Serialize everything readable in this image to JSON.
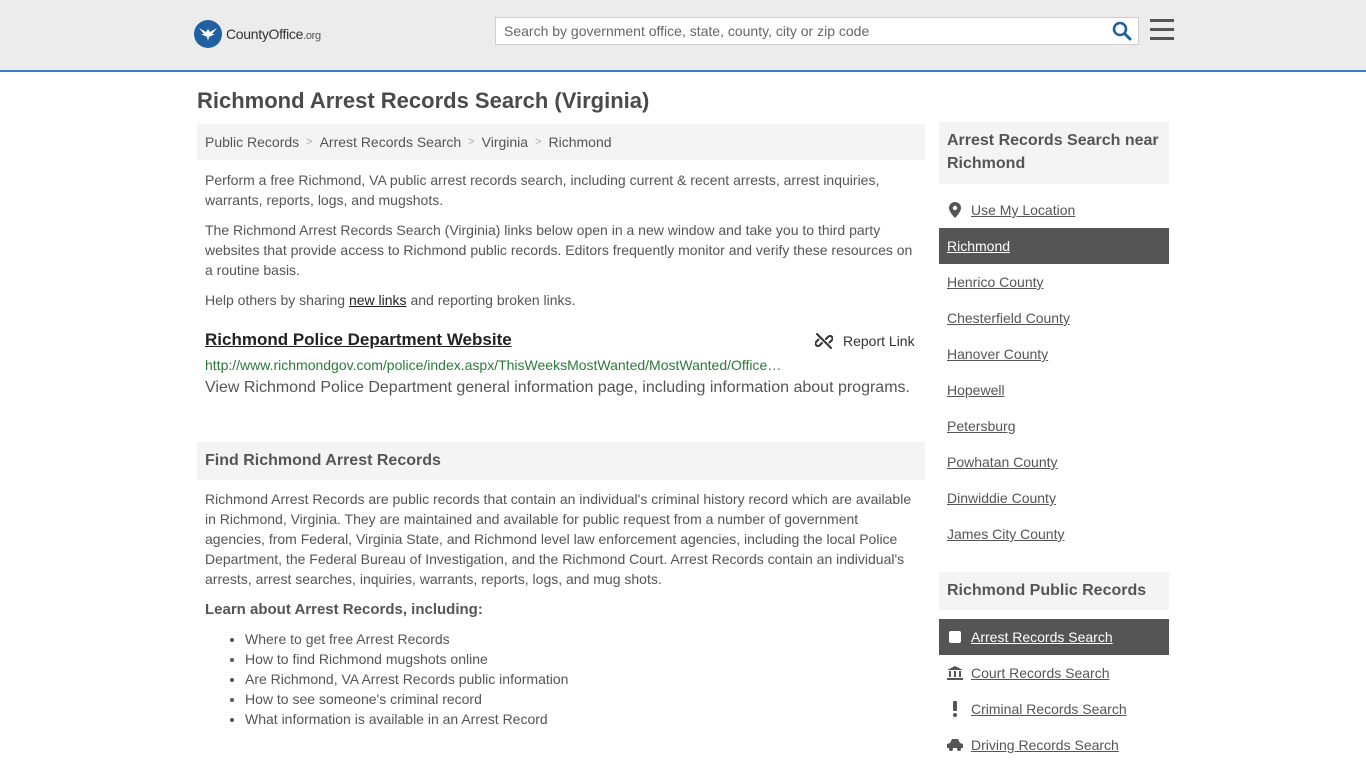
{
  "header": {
    "logo_text": "CountyOffice",
    "logo_suffix": ".org",
    "search_placeholder": "Search by government office, state, county, city or zip code"
  },
  "page_title": "Richmond Arrest Records Search (Virginia)",
  "breadcrumb": [
    "Public Records",
    "Arrest Records Search",
    "Virginia",
    "Richmond"
  ],
  "intro": {
    "p1": "Perform a free Richmond, VA public arrest records search, including current & recent arrests, arrest inquiries, warrants, reports, logs, and mugshots.",
    "p2": "The Richmond Arrest Records Search (Virginia) links below open in a new window and take you to third party websites that provide access to Richmond public records. Editors frequently monitor and verify these resources on a routine basis.",
    "p3_before": "Help others by sharing ",
    "p3_link": "new links",
    "p3_after": " and reporting broken links."
  },
  "listing": {
    "title": "Richmond Police Department Website",
    "report_label": "Report Link",
    "url": "http://www.richmondgov.com/police/index.aspx/ThisWeeksMostWanted/MostWanted/OfficeOfTheChief/index.aspx",
    "description": "View Richmond Police Department general information page, including information about programs."
  },
  "find_section": {
    "heading": "Find Richmond Arrest Records",
    "body": "Richmond Arrest Records are public records that contain an individual's criminal history record which are available in Richmond, Virginia. They are maintained and available for public request from a number of government agencies, from Federal, Virginia State, and Richmond level law enforcement agencies, including the local Police Department, the Federal Bureau of Investigation, and the Richmond Court. Arrest Records contain an individual's arrests, arrest searches, inquiries, warrants, reports, logs, and mug shots.",
    "learn_heading": "Learn about Arrest Records, including:",
    "learn_items": [
      "Where to get free Arrest Records",
      "How to find Richmond mugshots online",
      "Are Richmond, VA Arrest Records public information",
      "How to see someone's criminal record",
      "What information is available in an Arrest Record"
    ]
  },
  "sidebar": {
    "nearby_heading": "Arrest Records Search near Richmond",
    "use_location": "Use My Location",
    "nearby": [
      "Richmond",
      "Henrico County",
      "Chesterfield County",
      "Hanover County",
      "Hopewell",
      "Petersburg",
      "Powhatan County",
      "Dinwiddie County",
      "James City County"
    ],
    "records_heading": "Richmond Public Records",
    "records": [
      "Arrest Records Search",
      "Court Records Search",
      "Criminal Records Search",
      "Driving Records Search"
    ]
  }
}
